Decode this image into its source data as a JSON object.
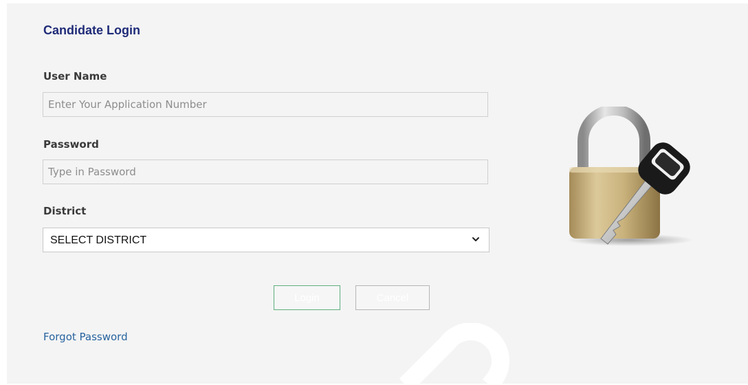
{
  "form": {
    "title": "Candidate Login",
    "username_label": "User Name",
    "username_placeholder": "Enter Your Application Number",
    "username_value": "",
    "password_label": "Password",
    "password_placeholder": "Type in Password",
    "password_value": "",
    "district_label": "District",
    "district_selected": "SELECT DISTRICT",
    "login_label": "Login",
    "cancel_label": "Cancel",
    "forgot_password_label": "Forgot Password"
  },
  "icons": {
    "lock": "lock-and-key-icon",
    "dropdown": "chevron-down-icon"
  },
  "colors": {
    "title": "#1f2b78",
    "link": "#27639f",
    "login_border": "#5fae7e",
    "panel_bg": "#f4f4f4"
  }
}
